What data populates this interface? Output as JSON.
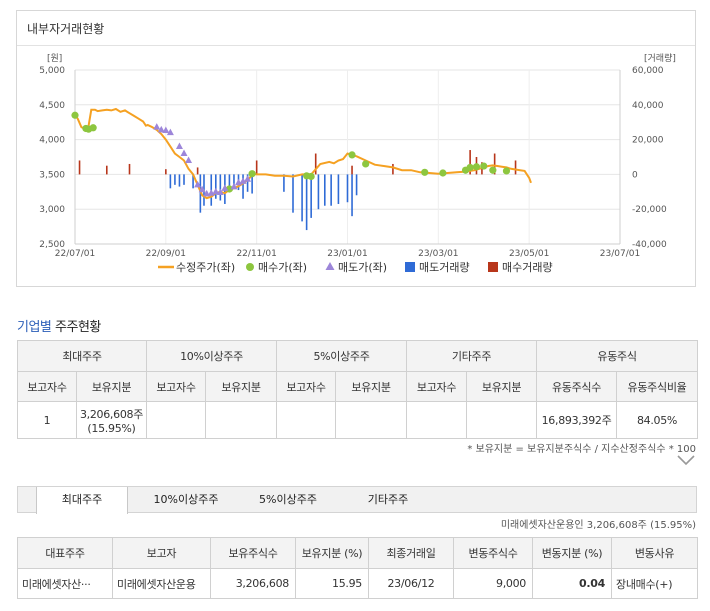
{
  "insider": {
    "title": "내부자거래현황"
  },
  "chart_data": {
    "type": "line",
    "left_unit": "[원]",
    "right_unit": "[거래량]",
    "y_left_ticks": [
      "5,000",
      "4,500",
      "4,000",
      "3,500",
      "3,000",
      "2,500"
    ],
    "y_right_ticks": [
      "60,000",
      "40,000",
      "20,000",
      "0",
      "-20,000",
      "-40,000"
    ],
    "ylim_left": [
      2500,
      5000
    ],
    "ylim_right": [
      -40000,
      60000
    ],
    "x_ticks": [
      "22/07/01",
      "22/09/01",
      "22/11/01",
      "23/01/01",
      "23/03/01",
      "23/05/01",
      "23/07/01"
    ],
    "legend": [
      "수정주가(좌)",
      "매수가(좌)",
      "매도가(좌)",
      "매도거래량",
      "매수거래량"
    ],
    "colors": {
      "price": "#f5a122",
      "buy": "#8dc63f",
      "sell": "#9d86d9",
      "sell_vol": "#2f6bd6",
      "buy_vol": "#b8361b"
    },
    "price_series": [
      [
        0,
        4350
      ],
      [
        0.03,
        4300
      ],
      [
        0.07,
        4180
      ],
      [
        0.1,
        4160
      ],
      [
        0.12,
        4150
      ],
      [
        0.15,
        4200
      ],
      [
        0.18,
        4430
      ],
      [
        0.22,
        4430
      ],
      [
        0.25,
        4410
      ],
      [
        0.3,
        4420
      ],
      [
        0.35,
        4430
      ],
      [
        0.4,
        4420
      ],
      [
        0.45,
        4440
      ],
      [
        0.5,
        4400
      ],
      [
        0.55,
        4420
      ],
      [
        0.6,
        4380
      ],
      [
        0.65,
        4340
      ],
      [
        0.7,
        4300
      ],
      [
        0.75,
        4260
      ],
      [
        0.78,
        4200
      ],
      [
        0.8,
        4210
      ],
      [
        0.85,
        4180
      ],
      [
        0.9,
        4140
      ],
      [
        0.95,
        4080
      ],
      [
        1.0,
        4000
      ],
      [
        1.05,
        3900
      ],
      [
        1.1,
        3800
      ],
      [
        1.15,
        3750
      ],
      [
        1.2,
        3700
      ],
      [
        1.25,
        3580
      ],
      [
        1.3,
        3500
      ],
      [
        1.35,
        3350
      ],
      [
        1.4,
        3200
      ],
      [
        1.45,
        3160
      ],
      [
        1.5,
        3180
      ],
      [
        1.55,
        3230
      ],
      [
        1.6,
        3250
      ],
      [
        1.65,
        3230
      ],
      [
        1.7,
        3280
      ],
      [
        1.75,
        3300
      ],
      [
        1.8,
        3330
      ],
      [
        1.85,
        3370
      ],
      [
        1.9,
        3420
      ],
      [
        1.93,
        3460
      ],
      [
        1.95,
        3510
      ],
      [
        2.0,
        3500
      ],
      [
        2.1,
        3500
      ],
      [
        2.2,
        3480
      ],
      [
        2.3,
        3480
      ],
      [
        2.4,
        3470
      ],
      [
        2.5,
        3500
      ],
      [
        2.6,
        3500
      ],
      [
        2.7,
        3650
      ],
      [
        2.8,
        3680
      ],
      [
        2.85,
        3660
      ],
      [
        2.9,
        3700
      ],
      [
        2.95,
        3720
      ],
      [
        3.0,
        3800
      ],
      [
        3.05,
        3780
      ],
      [
        3.1,
        3760
      ],
      [
        3.2,
        3700
      ],
      [
        3.3,
        3640
      ],
      [
        3.4,
        3620
      ],
      [
        3.5,
        3600
      ],
      [
        3.6,
        3560
      ],
      [
        3.7,
        3560
      ],
      [
        3.8,
        3530
      ],
      [
        3.9,
        3520
      ],
      [
        4.0,
        3510
      ],
      [
        4.1,
        3520
      ],
      [
        4.2,
        3530
      ],
      [
        4.3,
        3540
      ],
      [
        4.4,
        3560
      ],
      [
        4.5,
        3600
      ],
      [
        4.55,
        3620
      ],
      [
        4.6,
        3630
      ],
      [
        4.65,
        3620
      ],
      [
        4.7,
        3610
      ],
      [
        4.75,
        3600
      ],
      [
        4.8,
        3580
      ],
      [
        4.85,
        3570
      ],
      [
        4.9,
        3560
      ],
      [
        4.95,
        3550
      ],
      [
        5.0,
        3450
      ],
      [
        5.02,
        3380
      ]
    ],
    "buy_points": [
      [
        0,
        4350
      ],
      [
        0.12,
        4160
      ],
      [
        0.15,
        4150
      ],
      [
        0.2,
        4170
      ],
      [
        1.7,
        3290
      ],
      [
        1.95,
        3510
      ],
      [
        2.55,
        3480
      ],
      [
        2.6,
        3470
      ],
      [
        3.05,
        3780
      ],
      [
        3.2,
        3650
      ],
      [
        3.85,
        3530
      ],
      [
        4.05,
        3520
      ],
      [
        4.3,
        3560
      ],
      [
        4.35,
        3600
      ],
      [
        4.42,
        3610
      ],
      [
        4.5,
        3620
      ],
      [
        4.6,
        3560
      ],
      [
        4.75,
        3550
      ]
    ],
    "sell_points": [
      [
        0.9,
        4180
      ],
      [
        0.95,
        4140
      ],
      [
        1.0,
        4130
      ],
      [
        1.05,
        4100
      ],
      [
        1.15,
        3900
      ],
      [
        1.2,
        3800
      ],
      [
        1.25,
        3700
      ],
      [
        1.35,
        3350
      ],
      [
        1.4,
        3280
      ],
      [
        1.45,
        3220
      ],
      [
        1.5,
        3230
      ],
      [
        1.55,
        3250
      ],
      [
        1.6,
        3240
      ],
      [
        1.65,
        3300
      ],
      [
        1.75,
        3320
      ],
      [
        1.8,
        3380
      ],
      [
        1.85,
        3400
      ],
      [
        1.9,
        3430
      ]
    ],
    "buy_volumes": [
      [
        0.05,
        8000
      ],
      [
        0.35,
        5000
      ],
      [
        0.6,
        6000
      ],
      [
        1.0,
        3000
      ],
      [
        1.35,
        4000
      ],
      [
        2.0,
        8000
      ],
      [
        2.65,
        12000
      ],
      [
        3.05,
        5000
      ],
      [
        3.5,
        6000
      ],
      [
        4.35,
        14000
      ],
      [
        4.42,
        10000
      ],
      [
        4.48,
        7000
      ],
      [
        4.62,
        12000
      ],
      [
        4.85,
        8000
      ]
    ],
    "sell_volumes": [
      [
        1.05,
        -8000
      ],
      [
        1.1,
        -6000
      ],
      [
        1.15,
        -7000
      ],
      [
        1.2,
        -6000
      ],
      [
        1.3,
        -8000
      ],
      [
        1.38,
        -22000
      ],
      [
        1.42,
        -18000
      ],
      [
        1.5,
        -18000
      ],
      [
        1.55,
        -14000
      ],
      [
        1.6,
        -15000
      ],
      [
        1.65,
        -17000
      ],
      [
        1.7,
        -8000
      ],
      [
        1.75,
        -8000
      ],
      [
        1.8,
        -9000
      ],
      [
        1.85,
        -14000
      ],
      [
        1.9,
        -10000
      ],
      [
        1.95,
        -11000
      ],
      [
        2.3,
        -10000
      ],
      [
        2.4,
        -22000
      ],
      [
        2.5,
        -27000
      ],
      [
        2.55,
        -32000
      ],
      [
        2.6,
        -25000
      ],
      [
        2.68,
        -20000
      ],
      [
        2.75,
        -18000
      ],
      [
        2.82,
        -18000
      ],
      [
        2.9,
        -17000
      ],
      [
        3.0,
        -16000
      ],
      [
        3.05,
        -24000
      ],
      [
        3.1,
        -12000
      ]
    ]
  },
  "section": {
    "title_highlight": "기업별",
    "title_rest": " 주주현황"
  },
  "summary_table": {
    "groups": [
      "최대주주",
      "10%이상주주",
      "5%이상주주",
      "기타주주",
      "유동주식"
    ],
    "subheaders": [
      "보고자수",
      "보유지분",
      "보고자수",
      "보유지분",
      "보고자수",
      "보유지분",
      "보고자수",
      "보유지분",
      "유동주식수",
      "유동주식비율"
    ],
    "row": [
      "1",
      "3,206,608주",
      "(15.95%)",
      "",
      "",
      "",
      "",
      "",
      "",
      "16,893,392주",
      "84.05%"
    ]
  },
  "footnote": "* 보유지분 = 보유지분주식수 / 지수산정주식수 * 100",
  "tabs": [
    "최대주주",
    "10%이상주주",
    "5%이상주주",
    "기타주주"
  ],
  "holder_summary": "미래에셋자산운용인 3,206,608주 (15.95%)",
  "holder_table": {
    "headers": [
      "대표주주",
      "보고자",
      "보유주식수",
      "보유지분 (%)",
      "최종거래일",
      "변동주식수",
      "변동지분 (%)",
      "변동사유"
    ],
    "row": [
      "미래에셋자산···",
      "미래에셋자산운용",
      "3,206,608",
      "15.95",
      "23/06/12",
      "9,000",
      "0.04",
      "장내매수(+)"
    ]
  }
}
